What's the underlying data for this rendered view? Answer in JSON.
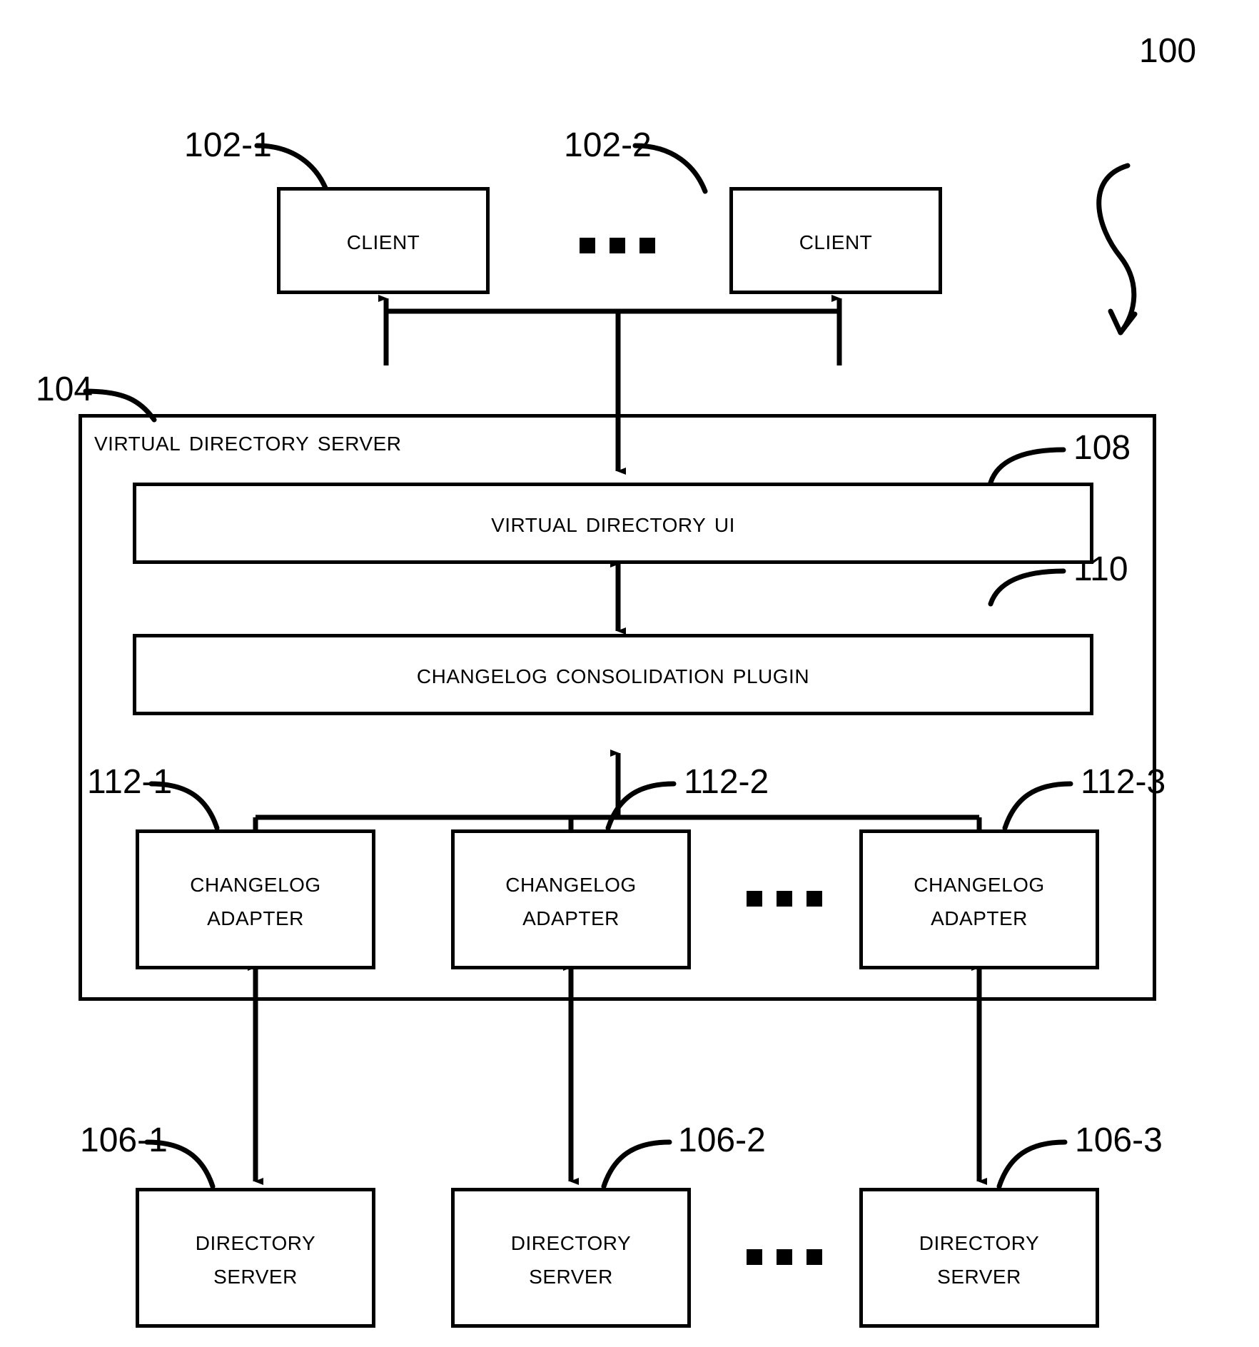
{
  "figure": {
    "ref_main": "100"
  },
  "clients": {
    "label": "Client",
    "ref_1": "102-1",
    "ref_2": "102-2",
    "ellipsis": "• • •"
  },
  "vds": {
    "title": "Virtual Directory Server",
    "ref": "104"
  },
  "ui_box": {
    "label": "Virtual Directory UI",
    "ref": "108"
  },
  "plugin_box": {
    "label": "Changelog Consolidation Plugin",
    "ref": "110"
  },
  "adapters": {
    "label": "Changelog\nAdapter",
    "ref_1": "112-1",
    "ref_2": "112-2",
    "ref_3": "112-3"
  },
  "directory_servers": {
    "label": "Directory\nServer",
    "ref_1": "106-1",
    "ref_2": "106-2",
    "ref_3": "106-3"
  }
}
